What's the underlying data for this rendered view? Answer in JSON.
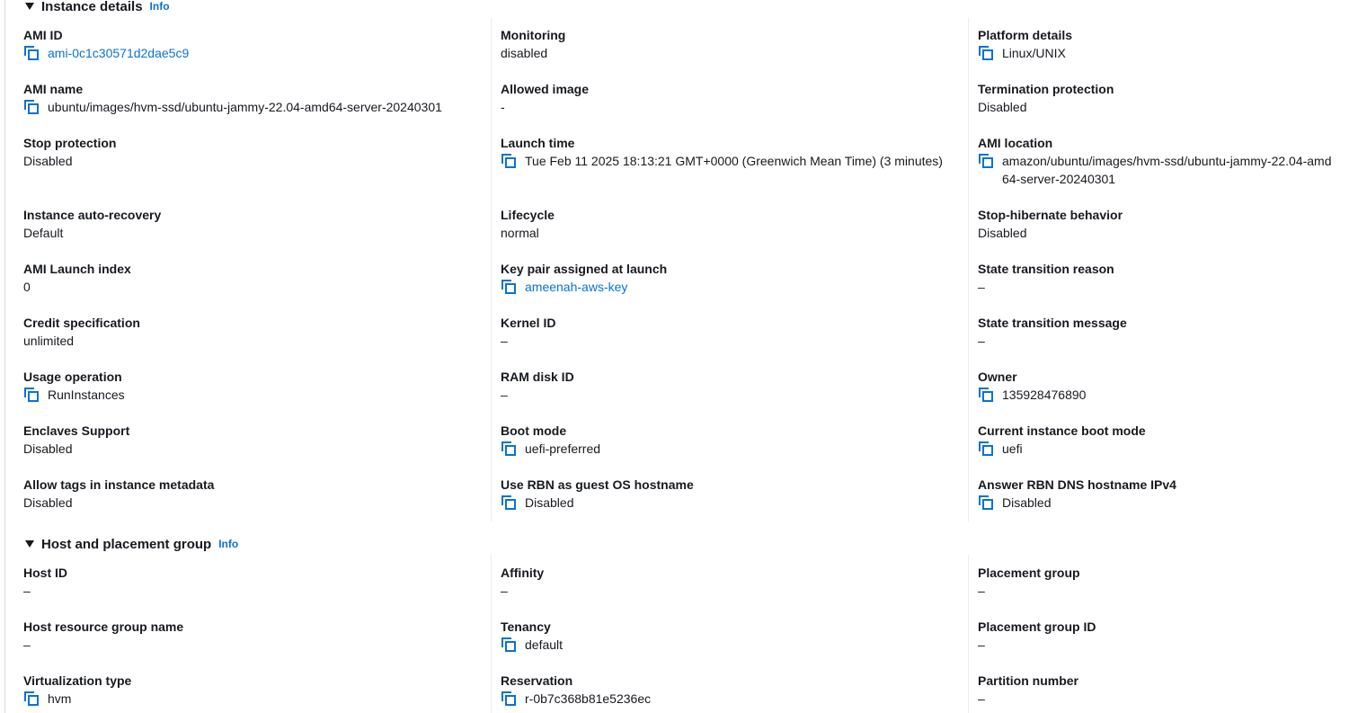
{
  "sections": {
    "instance_details": {
      "title": "Instance details",
      "info": "Info"
    },
    "host_placement": {
      "title": "Host and placement group",
      "info": "Info"
    }
  },
  "fields": {
    "ami_id": {
      "label": "AMI ID",
      "value": "ami-0c1c30571d2dae5c9"
    },
    "monitoring": {
      "label": "Monitoring",
      "value": "disabled"
    },
    "platform_details": {
      "label": "Platform details",
      "value": "Linux/UNIX"
    },
    "ami_name": {
      "label": "AMI name",
      "value": "ubuntu/images/hvm-ssd/ubuntu-jammy-22.04-amd64-server-20240301"
    },
    "allowed_image": {
      "label": "Allowed image",
      "value": "-"
    },
    "termination_protection": {
      "label": "Termination protection",
      "value": "Disabled"
    },
    "stop_protection": {
      "label": "Stop protection",
      "value": "Disabled"
    },
    "launch_time": {
      "label": "Launch time",
      "value": "Tue Feb 11 2025 18:13:21 GMT+0000 (Greenwich Mean Time) (3 minutes)"
    },
    "ami_location": {
      "label": "AMI location",
      "value": "amazon/ubuntu/images/hvm-ssd/ubuntu-jammy-22.04-amd64-server-20240301"
    },
    "instance_auto_recovery": {
      "label": "Instance auto-recovery",
      "value": "Default"
    },
    "lifecycle": {
      "label": "Lifecycle",
      "value": "normal"
    },
    "stop_hibernate_behavior": {
      "label": "Stop-hibernate behavior",
      "value": "Disabled"
    },
    "ami_launch_index": {
      "label": "AMI Launch index",
      "value": "0"
    },
    "key_pair": {
      "label": "Key pair assigned at launch",
      "value": "ameenah-aws-key"
    },
    "state_transition_reason": {
      "label": "State transition reason",
      "value": "–"
    },
    "credit_specification": {
      "label": "Credit specification",
      "value": "unlimited"
    },
    "kernel_id": {
      "label": "Kernel ID",
      "value": "–"
    },
    "state_transition_message": {
      "label": "State transition message",
      "value": "–"
    },
    "usage_operation": {
      "label": "Usage operation",
      "value": "RunInstances"
    },
    "ram_disk_id": {
      "label": "RAM disk ID",
      "value": "–"
    },
    "owner": {
      "label": "Owner",
      "value": "135928476890"
    },
    "enclaves_support": {
      "label": "Enclaves Support",
      "value": "Disabled"
    },
    "boot_mode": {
      "label": "Boot mode",
      "value": "uefi-preferred"
    },
    "current_boot_mode": {
      "label": "Current instance boot mode",
      "value": "uefi"
    },
    "allow_tags_metadata": {
      "label": "Allow tags in instance metadata",
      "value": "Disabled"
    },
    "use_rbn_hostname": {
      "label": "Use RBN as guest OS hostname",
      "value": "Disabled"
    },
    "answer_rbn_dns": {
      "label": "Answer RBN DNS hostname IPv4",
      "value": "Disabled"
    },
    "host_id": {
      "label": "Host ID",
      "value": "–"
    },
    "affinity": {
      "label": "Affinity",
      "value": "–"
    },
    "placement_group": {
      "label": "Placement group",
      "value": "–"
    },
    "host_resource_group_name": {
      "label": "Host resource group name",
      "value": "–"
    },
    "tenancy": {
      "label": "Tenancy",
      "value": "default"
    },
    "placement_group_id": {
      "label": "Placement group ID",
      "value": "–"
    },
    "virtualization_type": {
      "label": "Virtualization type",
      "value": "hvm"
    },
    "reservation": {
      "label": "Reservation",
      "value": "r-0b7c368b81e5236ec"
    },
    "partition_number": {
      "label": "Partition number",
      "value": "–"
    }
  },
  "icons": {
    "copy": "copy-icon"
  },
  "colors": {
    "link": "#0972d3",
    "text": "#16191f",
    "divider": "#e9ebed"
  }
}
